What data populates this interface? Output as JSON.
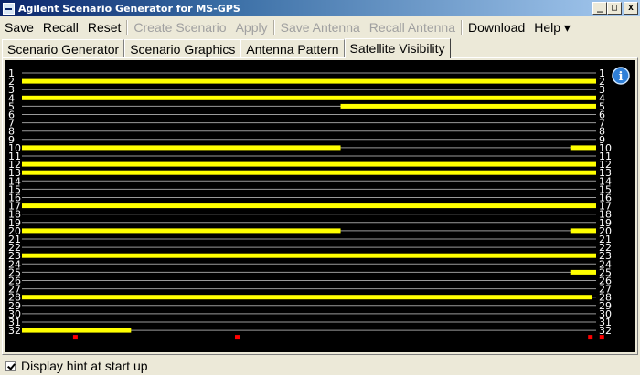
{
  "window": {
    "title": "Agilent Scenario Generator for MS-GPS",
    "minimize": "_",
    "maximize": "□",
    "close": "x"
  },
  "menu": [
    {
      "label": "Save",
      "enabled": true
    },
    {
      "label": "Recall",
      "enabled": true
    },
    {
      "label": "Reset",
      "enabled": true
    },
    {
      "sep": true
    },
    {
      "label": "Create Scenario",
      "enabled": false
    },
    {
      "label": "Apply",
      "enabled": false
    },
    {
      "sep": true
    },
    {
      "label": "Save Antenna",
      "enabled": false
    },
    {
      "label": "Recall Antenna",
      "enabled": false
    },
    {
      "sep": true
    },
    {
      "label": "Download",
      "enabled": true
    },
    {
      "label": "Help ▾",
      "enabled": true
    }
  ],
  "tabs": [
    {
      "label": "Scenario Generator",
      "active": false
    },
    {
      "label": "Scenario Graphics",
      "active": false
    },
    {
      "label": "Antenna Pattern",
      "active": false
    },
    {
      "label": "Satellite Visibility",
      "active": true
    }
  ],
  "chart_data": {
    "type": "visibility-timeline",
    "satellites": [
      "1",
      "2",
      "3",
      "4",
      "5",
      "6",
      "7",
      "8",
      "9",
      "10",
      "11",
      "12",
      "13",
      "14",
      "15",
      "16",
      "17",
      "18",
      "19",
      "20",
      "21",
      "22",
      "23",
      "24",
      "25",
      "26",
      "27",
      "28",
      "29",
      "30",
      "31",
      "32"
    ],
    "x_range": [
      0,
      1
    ],
    "visibility": [
      {
        "sat": 2,
        "intervals": [
          [
            0.0,
            1.0
          ]
        ]
      },
      {
        "sat": 4,
        "intervals": [
          [
            0.0,
            1.0
          ]
        ]
      },
      {
        "sat": 5,
        "intervals": [
          [
            0.555,
            1.0
          ]
        ]
      },
      {
        "sat": 10,
        "intervals": [
          [
            0.0,
            0.555
          ],
          [
            0.955,
            1.0
          ]
        ]
      },
      {
        "sat": 12,
        "intervals": [
          [
            0.0,
            1.0
          ]
        ]
      },
      {
        "sat": 13,
        "intervals": [
          [
            0.0,
            1.0
          ]
        ]
      },
      {
        "sat": 17,
        "intervals": [
          [
            0.0,
            1.0
          ]
        ]
      },
      {
        "sat": 20,
        "intervals": [
          [
            0.0,
            0.555
          ],
          [
            0.955,
            1.0
          ]
        ]
      },
      {
        "sat": 23,
        "intervals": [
          [
            0.0,
            1.0
          ]
        ]
      },
      {
        "sat": 25,
        "intervals": [
          [
            0.955,
            1.0
          ]
        ]
      },
      {
        "sat": 28,
        "intervals": [
          [
            0.0,
            0.993
          ]
        ]
      },
      {
        "sat": 32,
        "intervals": [
          [
            0.0,
            0.19
          ]
        ]
      }
    ],
    "markers": [
      0.093,
      0.375,
      0.99,
      1.01
    ],
    "colors": {
      "background": "#000000",
      "grid": "#9a9a9a",
      "bar": "#ffff00",
      "marker": "#ff0000",
      "label": "#ffffff"
    }
  },
  "info_icon": "info-icon",
  "footer": {
    "checkbox_checked": true,
    "label": "Display hint at start up"
  }
}
